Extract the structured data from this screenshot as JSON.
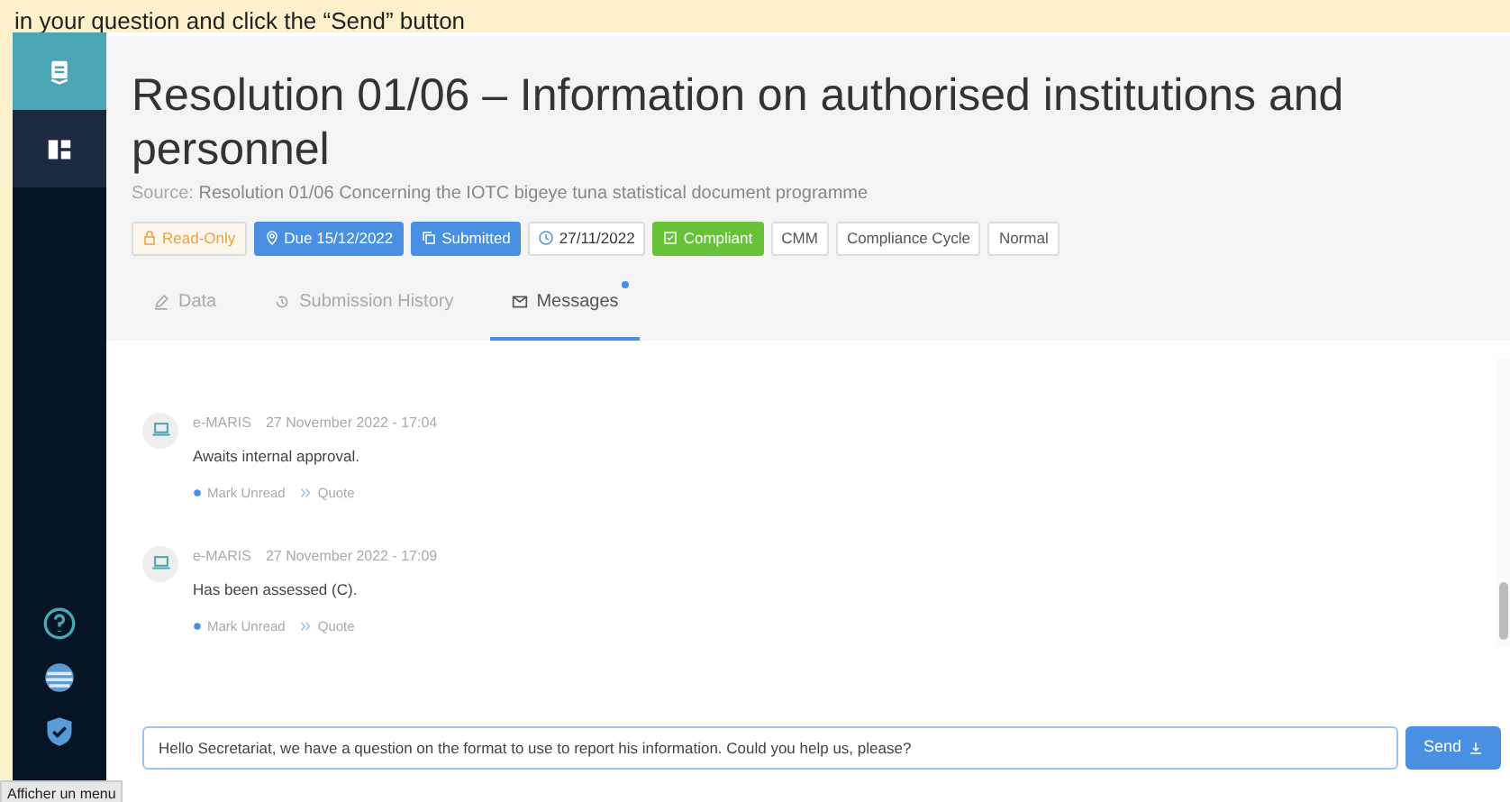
{
  "banner": {
    "text": "in your question and click the “Send” button"
  },
  "sidebar": {
    "top_items": [
      {
        "kind": "document",
        "selected": true
      },
      {
        "kind": "dashboard",
        "selected": false
      }
    ],
    "bottom_items": [
      {
        "kind": "help"
      },
      {
        "kind": "globe"
      },
      {
        "kind": "shield"
      }
    ],
    "tooltip": "Afficher un menu"
  },
  "page": {
    "title": "Resolution 01/06 – Information on authorised institutions and personnel",
    "source_label": "Source:",
    "source": "Resolution 01/06 Concerning the IOTC bigeye tuna statistical document programme"
  },
  "tags": [
    {
      "kind": "lock",
      "text": "Read-Only",
      "color": "#e8a33d"
    },
    {
      "kind": "pin",
      "text": "Due 15/12/2022",
      "color": "#4a90e2"
    },
    {
      "kind": "copy",
      "text": "Submitted",
      "color": "#4a90e2"
    },
    {
      "kind": "clock",
      "text": "27/11/2022",
      "color": "#4a90e2"
    },
    {
      "kind": "check",
      "text": "Compliant",
      "color": "#67c23a"
    },
    {
      "kind": "plain",
      "text": "CMM",
      "color": "#555555"
    },
    {
      "kind": "plain",
      "text": "Compliance Cycle",
      "color": "#555555"
    },
    {
      "kind": "plain",
      "text": "Normal",
      "color": "#555555"
    }
  ],
  "tabs": [
    {
      "kind": "pencil",
      "label": "Data",
      "selected": false,
      "badge": false
    },
    {
      "kind": "history",
      "label": "Submission History",
      "selected": false,
      "badge": false
    },
    {
      "kind": "mail",
      "label": "Messages",
      "selected": true,
      "badge": true
    }
  ],
  "messages": [
    {
      "author": "e-MARIS",
      "time": "27 November 2022 - 17:04",
      "text": "Awaits internal approval.",
      "actions": [
        "Mark Unread",
        "Quote"
      ]
    },
    {
      "author": "e-MARIS",
      "time": "27 November 2022 - 17:09",
      "text": "Has been assessed (C).",
      "actions": [
        "Mark Unread",
        "Quote"
      ]
    }
  ],
  "composer": {
    "value": "Hello Secretariat, we have a question on the format to use to report his information. Could you help us, please?",
    "button": "Send"
  }
}
